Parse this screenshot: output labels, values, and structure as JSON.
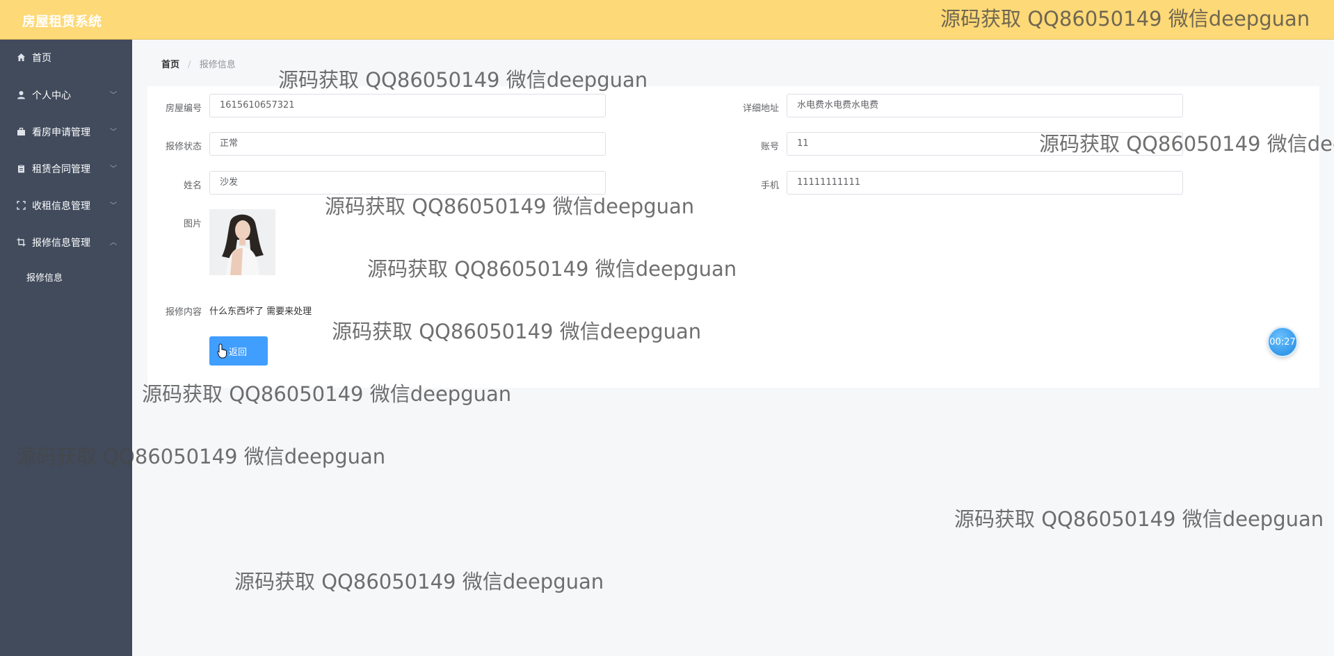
{
  "header": {
    "brand": "房屋租赁系统"
  },
  "sidebar": {
    "items": [
      {
        "label": "首页",
        "icon": "home-icon"
      },
      {
        "label": "个人中心",
        "icon": "user-icon"
      },
      {
        "label": "看房申请管理",
        "icon": "briefcase-icon"
      },
      {
        "label": "租赁合同管理",
        "icon": "clipboard-icon"
      },
      {
        "label": "收租信息管理",
        "icon": "fullscreen-icon"
      },
      {
        "label": "报修信息管理",
        "icon": "crop-icon"
      }
    ],
    "subitem": "报修信息"
  },
  "breadcrumb": {
    "home": "首页",
    "sep": "/",
    "current": "报修信息"
  },
  "form": {
    "house_no_label": "房屋编号",
    "house_no_value": "1615610657321",
    "address_label": "详细地址",
    "address_value": "水电费水电费水电费",
    "status_label": "报修状态",
    "status_value": "正常",
    "account_label": "账号",
    "account_value": "11",
    "name_label": "姓名",
    "name_value": "沙发",
    "phone_label": "手机",
    "phone_value": "11111111111",
    "image_label": "图片",
    "content_label": "报修内容",
    "content_value": "什么东西坏了 需要来处理",
    "back_label": "返回"
  },
  "timer": "00:27",
  "watermark": "源码获取 QQ86050149 微信deepguan",
  "colors": {
    "topbar": "#fed977",
    "sidebar": "#414b5c",
    "primary": "#409eff"
  }
}
